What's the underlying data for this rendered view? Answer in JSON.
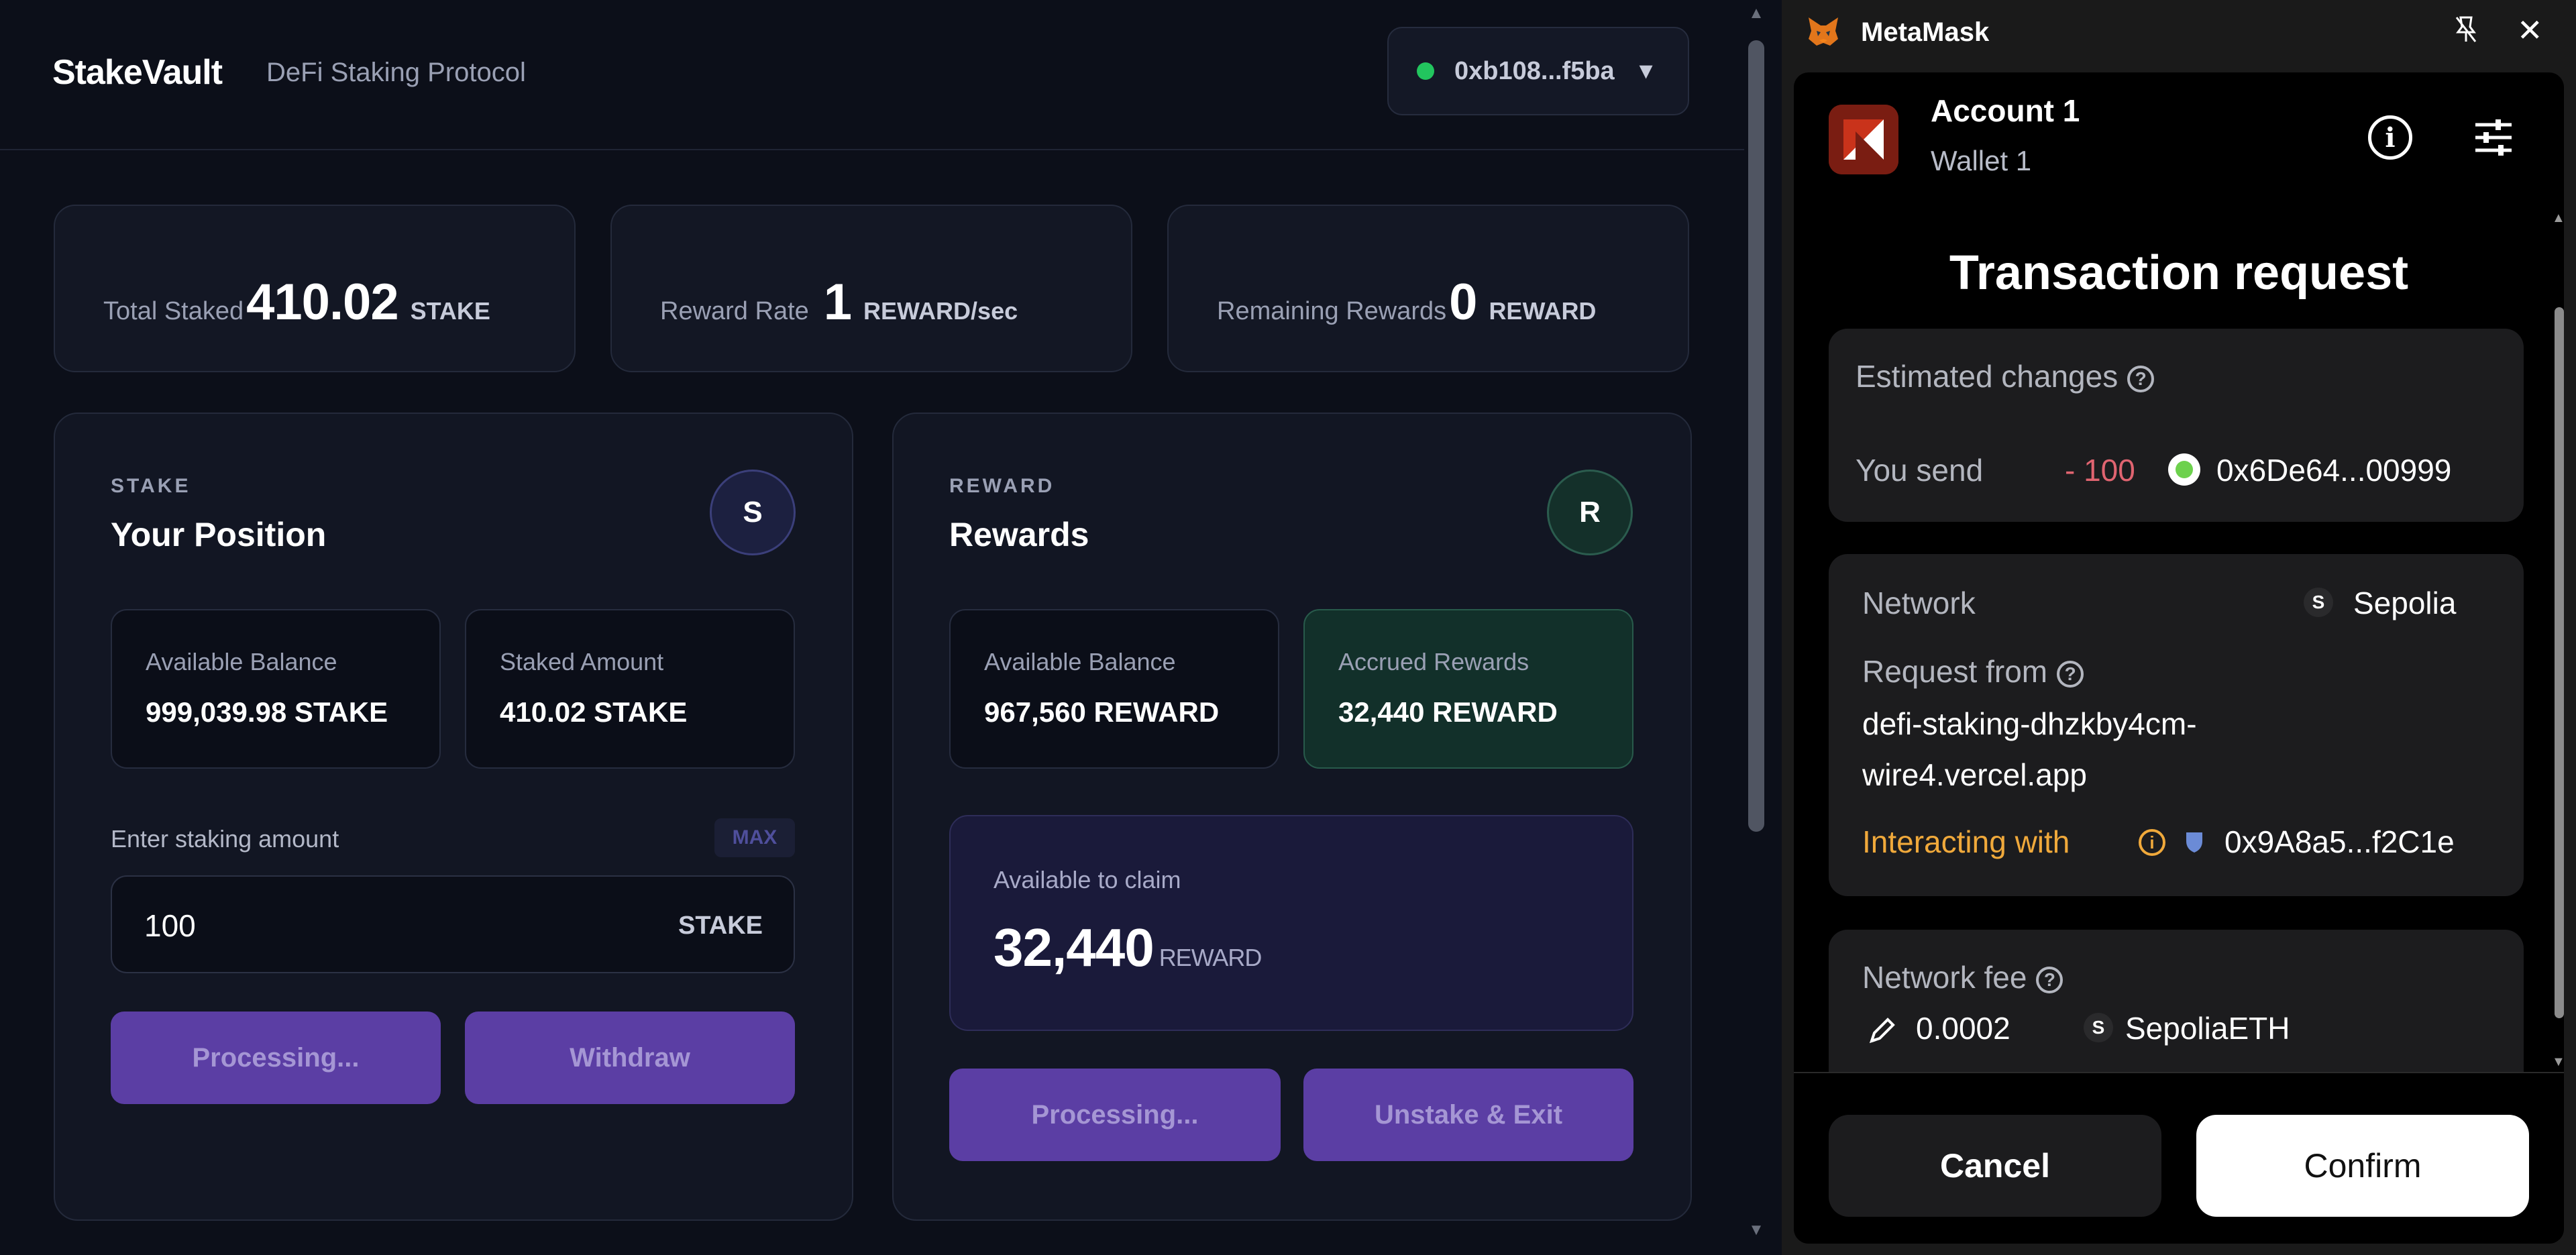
{
  "app": {
    "brand": "StakeVault",
    "tagline": "DeFi Staking Protocol",
    "wallet_address": "0xb108...f5ba",
    "status_color": "#22c55e",
    "accent_color": "#5b3ea4"
  },
  "stats": [
    {
      "label": "Total Staked",
      "value": "410.02",
      "unit": "STAKE"
    },
    {
      "label": "Reward Rate",
      "value": "1",
      "unit": "REWARD/sec"
    },
    {
      "label": "Remaining Rewards",
      "value": "0",
      "unit": "REWARD"
    }
  ],
  "stake_panel": {
    "kicker": "STAKE",
    "title": "Your Position",
    "badge": "S",
    "available_label": "Available Balance",
    "available_value": "999,039.98 STAKE",
    "staked_label": "Staked Amount",
    "staked_value": "410.02 STAKE",
    "input_label": "Enter staking amount",
    "max_label": "MAX",
    "input_value": "100",
    "input_unit": "STAKE",
    "primary_button": "Processing...",
    "secondary_button": "Withdraw"
  },
  "reward_panel": {
    "kicker": "REWARD",
    "title": "Rewards",
    "badge": "R",
    "available_label": "Available Balance",
    "available_value": "967,560 REWARD",
    "accrued_label": "Accrued Rewards",
    "accrued_value": "32,440 REWARD",
    "claim_label": "Available to claim",
    "claim_value": "32,440",
    "claim_unit": "REWARD",
    "primary_button": "Processing...",
    "secondary_button": "Unstake & Exit"
  },
  "metamask": {
    "title": "MetaMask",
    "account_name": "Account 1",
    "wallet_name": "Wallet 1",
    "request_title": "Transaction request",
    "estimated_changes_label": "Estimated changes",
    "you_send_label": "You send",
    "send_amount": "- 100",
    "send_token": "0x6De64...00999",
    "network_label": "Network",
    "network_letter": "S",
    "network_value": "Sepolia",
    "request_from_label": "Request from",
    "request_from_value_line1": "defi-staking-dhzkby4cm-",
    "request_from_value_line2": "wire4.vercel.app",
    "interacting_label": "Interacting with",
    "interacting_value": "0x9A8a5...f2C1e",
    "network_fee_label": "Network fee",
    "fee_amount": "0.0002",
    "fee_letter": "S",
    "fee_token": "SepoliaETH",
    "cancel_label": "Cancel",
    "confirm_label": "Confirm",
    "icons": [
      "metamask-fox-icon",
      "unpin-icon",
      "close-icon",
      "info-icon",
      "settings-sliders-icon",
      "help-icon",
      "pencil-icon",
      "shield-icon"
    ]
  }
}
